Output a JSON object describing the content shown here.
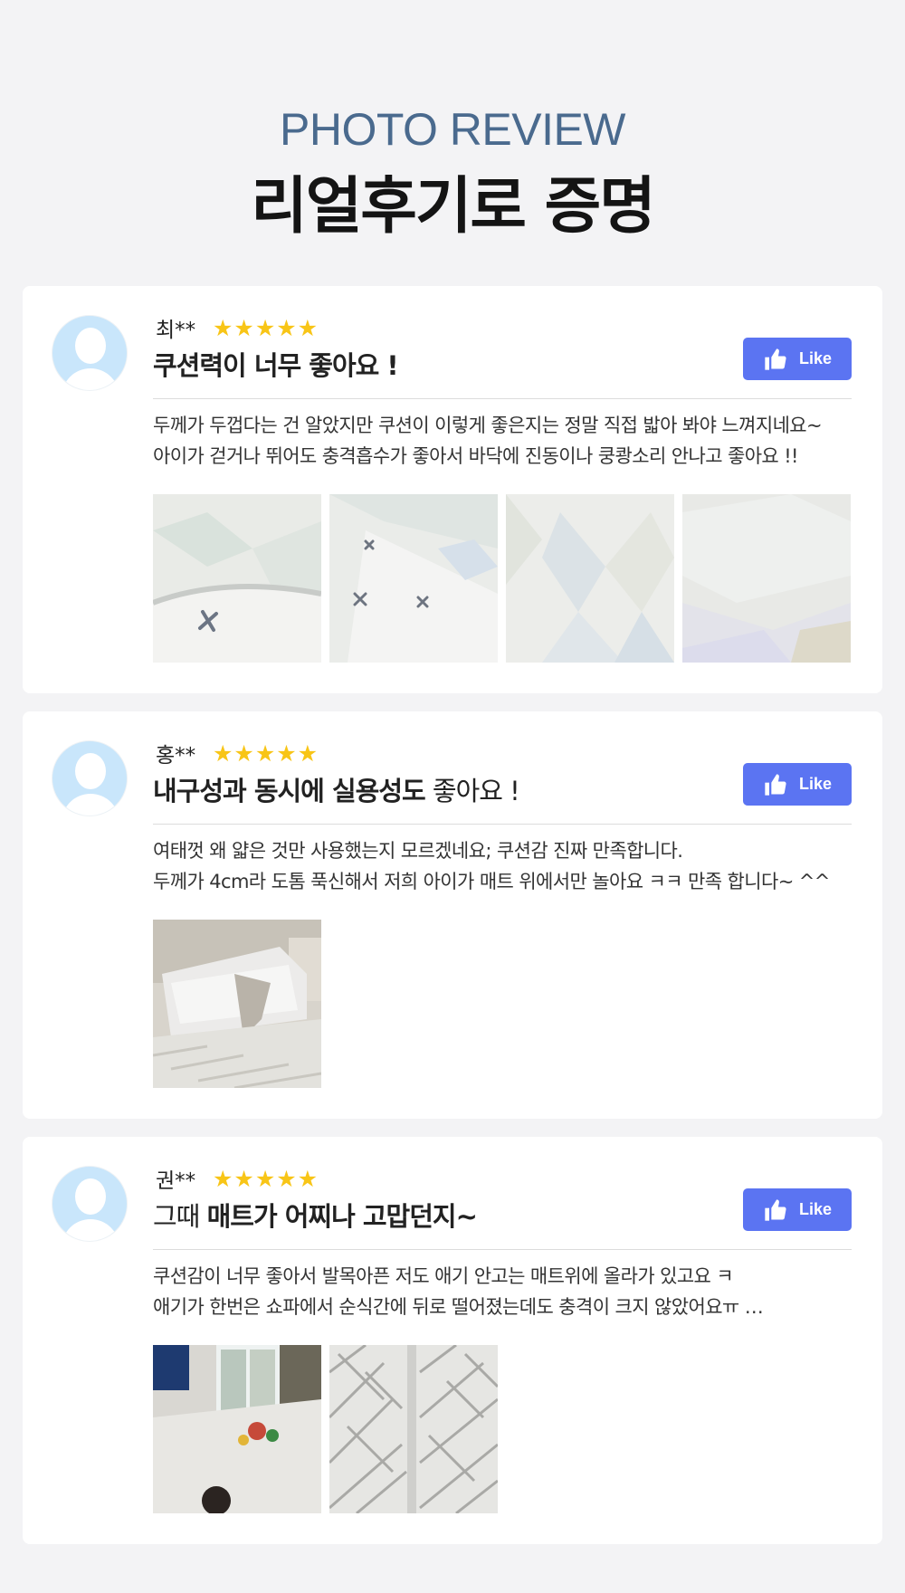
{
  "header": {
    "eyebrow": "PHOTO REVIEW",
    "headline": "리얼후기로 증명"
  },
  "colors": {
    "background": "#f3f3f5",
    "eyebrow": "#4a6a8e",
    "star": "#f8c517",
    "like_button": "#5b74f2",
    "avatar": "#c9e6fb"
  },
  "reviews": [
    {
      "reviewer": "최**",
      "rating": "★★★★★",
      "title_bold": "쿠션력이 너무 좋아요 !",
      "title_rest": "",
      "like_label": "Like",
      "like_icon": "thumbs-up-icon",
      "lines": [
        "두께가 두껍다는 건 알았지만 쿠션이 이렇게 좋은지는 정말 직접 밟아 봐야 느껴지네요~",
        "아이가 걷거나 뛰어도 충격흡수가 좋아서 바닥에 진동이나 쿵쾅소리 안나고 좋아요 !!"
      ]
    },
    {
      "reviewer": "홍**",
      "rating": "★★★★★",
      "title_bold": "내구성과 동시에 실용성도",
      "title_rest": " 좋아요 !",
      "like_label": "Like",
      "like_icon": "thumbs-up-icon",
      "lines": [
        "여태껏 왜 얇은 것만 사용했는지 모르겠네요; 쿠션감 진짜 만족합니다.",
        "두께가 4cm라 도톰 푹신해서 저희 아이가 매트 위에서만 놀아요 ㅋㅋ 만족 합니다~ ^^"
      ]
    },
    {
      "reviewer": "권**",
      "rating": "★★★★★",
      "title_bold": "매트가 어찌나 고맙던지~",
      "title_rest": "",
      "title_prefix": "그때 ",
      "like_label": "Like",
      "like_icon": "thumbs-up-icon",
      "lines": [
        "쿠션감이 너무 좋아서 발목아픈 저도 애기 안고는 매트위에 올라가 있고요 ㅋ",
        "애기가 한번은 쇼파에서 순식간에 뒤로 떨어졌는데도 충격이 크지 않았어요ㅠ …"
      ]
    }
  ]
}
